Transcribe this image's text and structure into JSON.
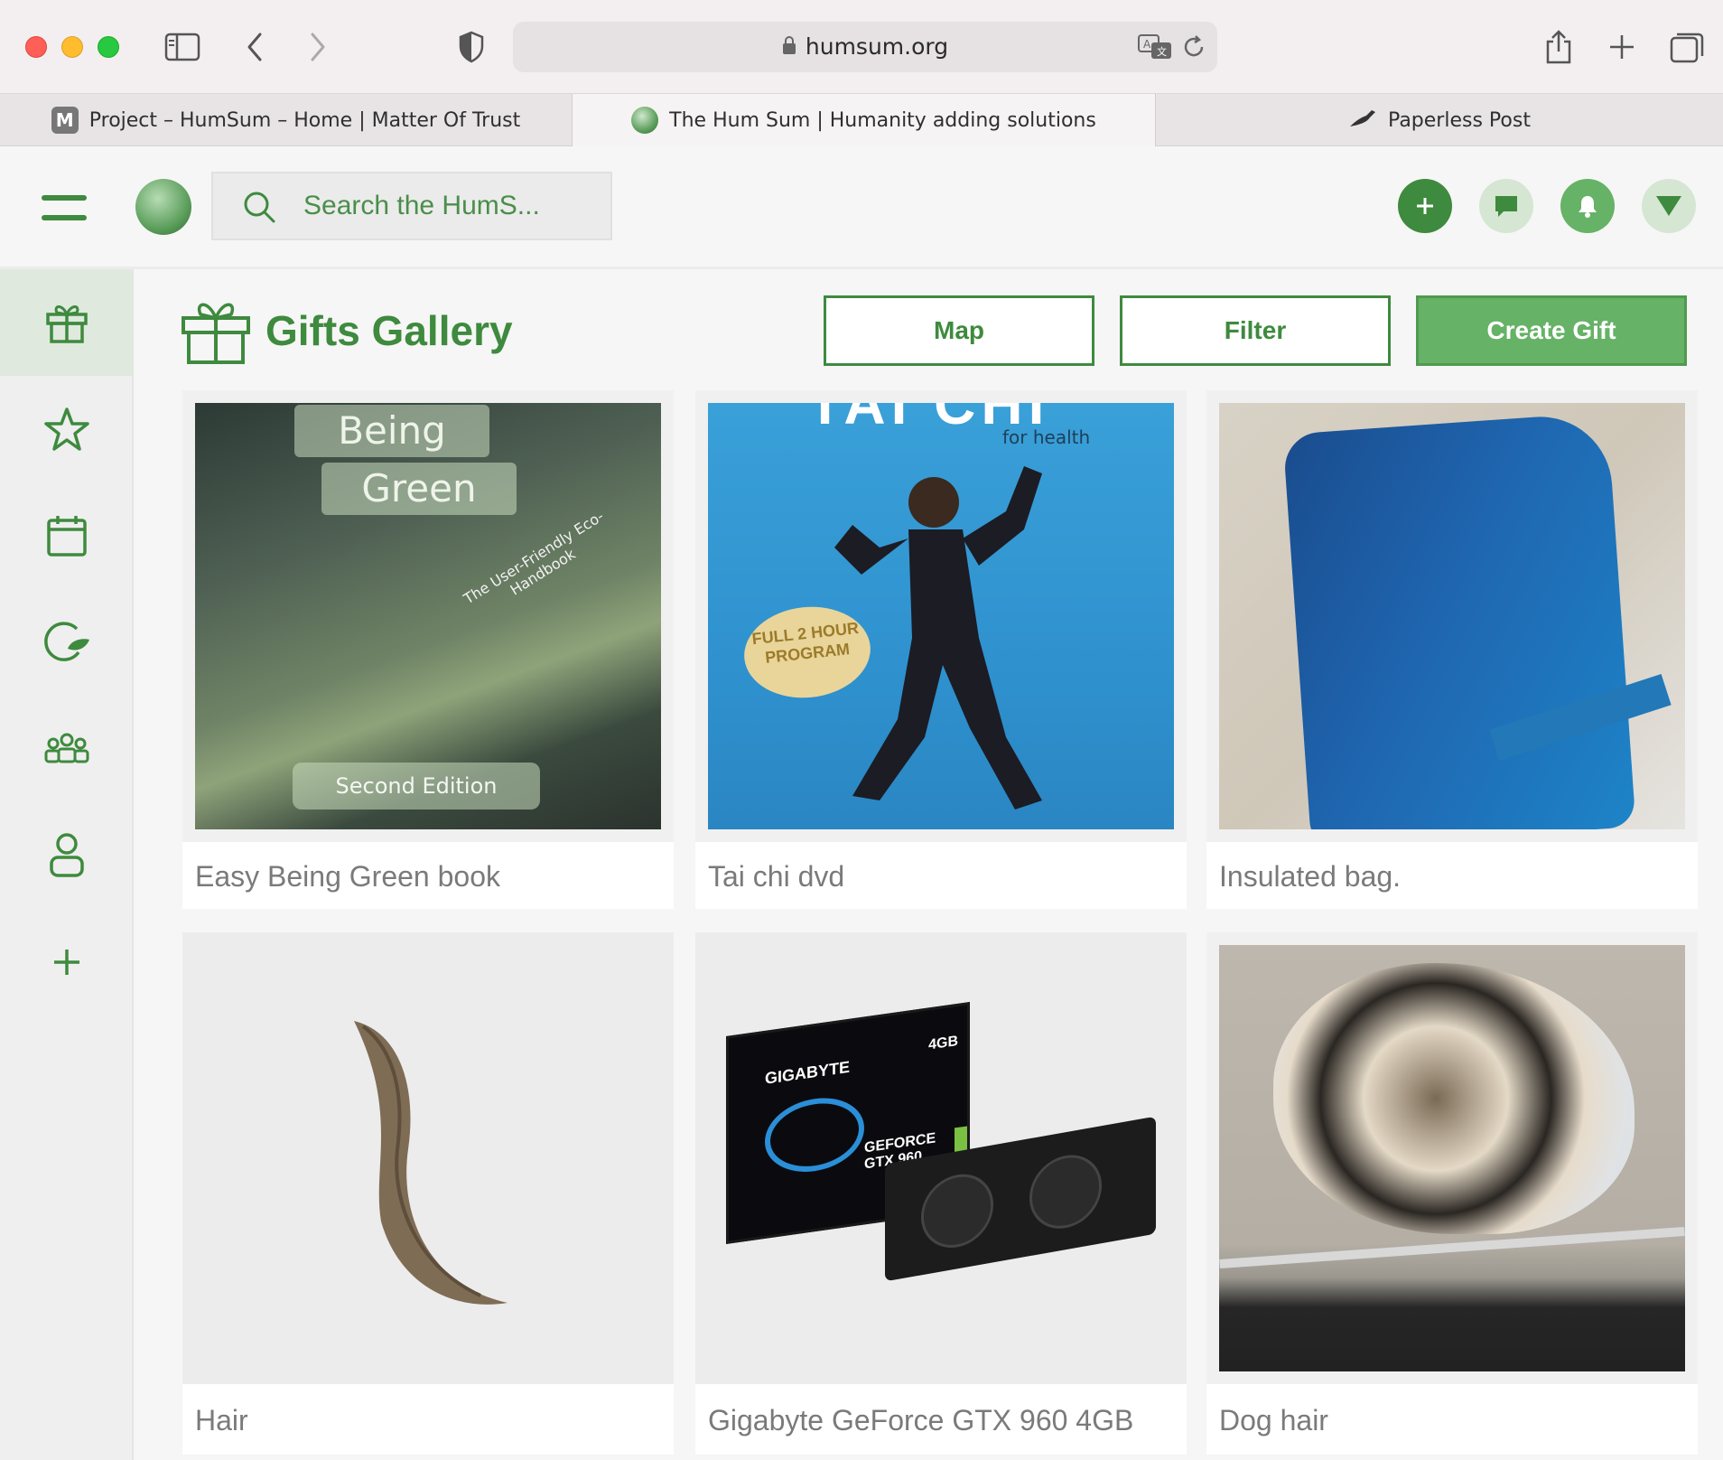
{
  "browser": {
    "url": "humsum.org",
    "tabs": [
      {
        "label": "Project – HumSum – Home | Matter Of Trust",
        "favicon": "M"
      },
      {
        "label": "The Hum Sum | Humanity adding solutions",
        "favicon": "globe"
      },
      {
        "label": "Paperless Post",
        "favicon": "bird"
      }
    ]
  },
  "header": {
    "search_placeholder": "Search the HumS..."
  },
  "page": {
    "title": "Gifts Gallery",
    "buttons": {
      "map": "Map",
      "filter": "Filter",
      "create": "Create Gift"
    }
  },
  "gifts": [
    {
      "title": "Easy Being Green book",
      "image_text": {
        "line1": "Being",
        "line2": "Green",
        "sub": "The User-Friendly Eco-Handbook",
        "edition": "Second Edition"
      }
    },
    {
      "title": "Tai chi dvd",
      "image_text": {
        "top": "TAI CHI",
        "sub": "for health",
        "badge": "FULL 2 HOUR PROGRAM"
      }
    },
    {
      "title": "Insulated bag."
    },
    {
      "title": "Hair"
    },
    {
      "title": "Gigabyte GeForce GTX 960 4GB",
      "image_text": {
        "brand": "GIGABYTE",
        "model": "GEFORCE GTX 960",
        "mem": "4GB"
      }
    },
    {
      "title": "Dog hair"
    }
  ],
  "colors": {
    "brand_green": "#3e8a3e",
    "button_green": "#66b266"
  }
}
